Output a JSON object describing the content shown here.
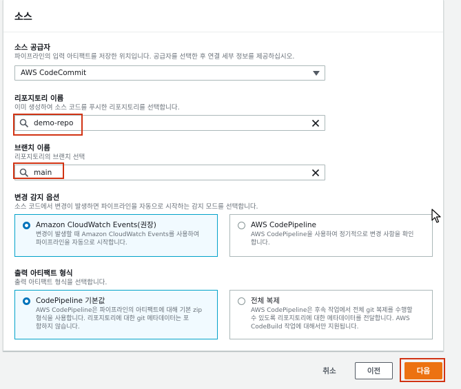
{
  "panel": {
    "title": "소스"
  },
  "source_provider": {
    "label": "소스 공급자",
    "description": "파이프라인의 입력 아티팩트를 저장한 위치입니다. 공급자를 선택한 후 연결 세부 정보를 제공하십시오.",
    "selected": "AWS CodeCommit"
  },
  "repository": {
    "label": "리포지토리 이름",
    "description": "이미 생성하여 소스 코드를 푸시한 리포지토리를 선택합니다.",
    "value": "demo-repo"
  },
  "branch": {
    "label": "브랜치 이름",
    "description": "리포지토리의 브랜치 선택",
    "value": "main"
  },
  "change_detection": {
    "label": "변경 감지 옵션",
    "description": "소스 코드에서 변경이 발생하면 파이프라인을 자동으로 시작하는 감지 모드를 선택합니다.",
    "options": [
      {
        "title": "Amazon CloudWatch Events(권장)",
        "desc1": "변경이 발생할 때 Amazon CloudWatch Events를 사용하여",
        "desc2": "파이프라인을 자동으로 시작합니다.",
        "selected": true
      },
      {
        "title": "AWS CodePipeline",
        "desc1": "AWS CodePipeline을 사용하여 정기적으로 변경 사항을 확인",
        "desc2": "합니다.",
        "selected": false
      }
    ]
  },
  "output_format": {
    "label": "출력 아티팩트 형식",
    "description": "출력 아티팩트 형식을 선택합니다.",
    "options": [
      {
        "title": "CodePipeline 기본값",
        "desc1": "AWS CodePipeline은 파이프라인의 아티팩트에 대해 기본 zip",
        "desc2": "형식을 사용합니다. 리포지토리에 대한 git 메타데이터는 포",
        "desc3": "함하지 않습니다.",
        "selected": true
      },
      {
        "title": "전체 복제",
        "desc1": "AWS CodePipeline은 후속 작업에서 전체 git 복제를 수행할",
        "desc2": "수 있도록 리포지토리에 대한 메타데이터를 전달합니다. AWS",
        "desc3": "CodeBuild 작업에 대해서만 지원됩니다.",
        "selected": false
      }
    ]
  },
  "footer": {
    "cancel": "취소",
    "previous": "이전",
    "next": "다음"
  },
  "colors": {
    "accent": "#0073bb",
    "primary_button": "#ec7211",
    "highlight": "#d13212"
  }
}
